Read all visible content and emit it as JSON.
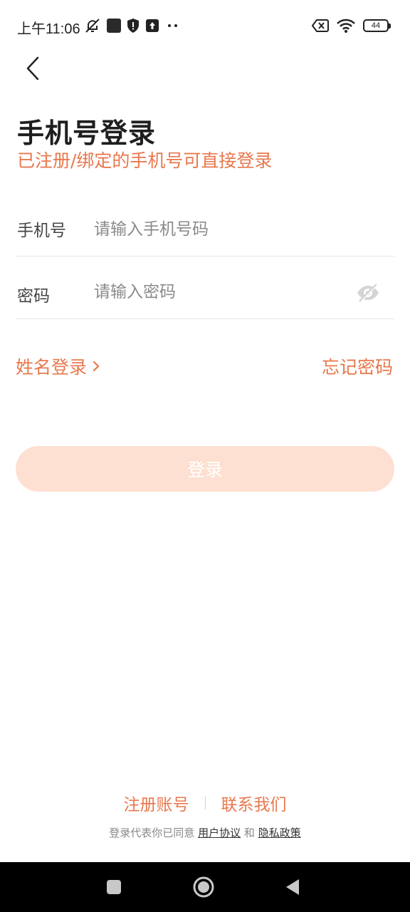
{
  "status_bar": {
    "time": "上午11:06",
    "battery": "44",
    "icons": [
      "bell-off-icon",
      "app-icon",
      "shield-icon",
      "upload-icon",
      "more-dots-icon",
      "sim-x-icon",
      "wifi-icon",
      "battery-icon"
    ]
  },
  "header": {
    "back_icon": "chevron-left-icon",
    "title": "手机号登录",
    "subtitle": "已注册/绑定的手机号可直接登录"
  },
  "form": {
    "phone": {
      "label": "手机号",
      "value": "",
      "placeholder": "请输入手机号码"
    },
    "password": {
      "label": "密码",
      "value": "",
      "placeholder": "请输入密码",
      "toggle_icon": "eye-off-icon"
    }
  },
  "links": {
    "name_login": "姓名登录",
    "name_login_icon": "chevron-right-icon",
    "forgot_password": "忘记密码"
  },
  "login_button": "登录",
  "footer": {
    "register": "注册账号",
    "contact": "联系我们",
    "agree_prefix": "登录代表你已同意",
    "user_agreement": "用户协议",
    "and": "和",
    "privacy_policy": "隐私政策"
  },
  "colors": {
    "accent": "#e8784e",
    "button_disabled": "#fde0d1",
    "divider": "#e6e6e6"
  }
}
